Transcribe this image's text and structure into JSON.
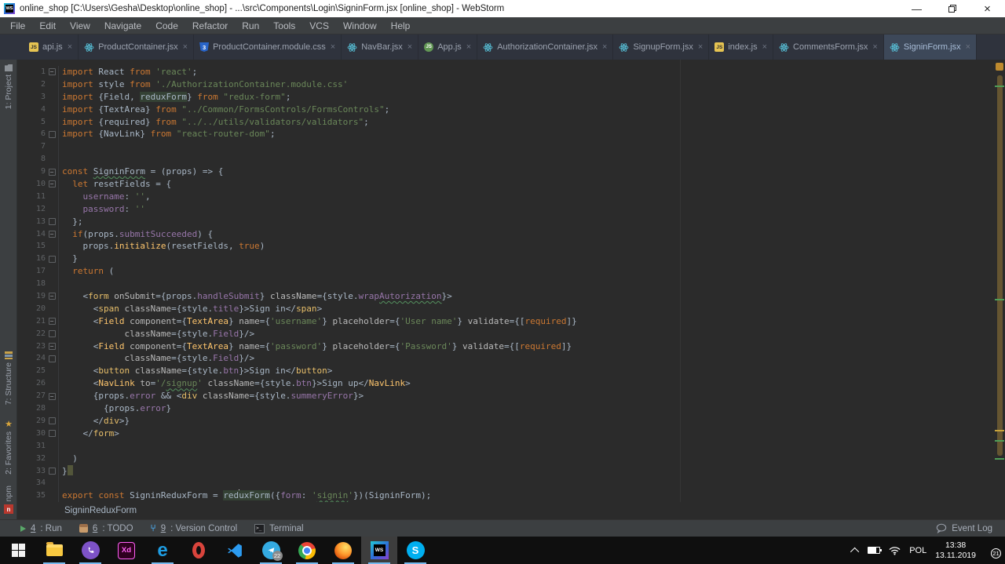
{
  "window": {
    "title": "online_shop [C:\\Users\\Gesha\\Desktop\\online_shop] - ...\\src\\Components\\Login\\SigninForm.jsx [online_shop] - WebStorm",
    "app_icon_label": "WS",
    "controls": {
      "minimize": "—",
      "close": "×"
    }
  },
  "menu": {
    "items": [
      "File",
      "Edit",
      "View",
      "Navigate",
      "Code",
      "Refactor",
      "Run",
      "Tools",
      "VCS",
      "Window",
      "Help"
    ]
  },
  "tabs": {
    "close_glyph": "×",
    "items": [
      {
        "label": "api.js",
        "icon": "js"
      },
      {
        "label": "ProductContainer.jsx",
        "icon": "react"
      },
      {
        "label": "ProductContainer.module.css",
        "icon": "css"
      },
      {
        "label": "NavBar.jsx",
        "icon": "react"
      },
      {
        "label": "App.js",
        "icon": "appjs"
      },
      {
        "label": "AuthorizationContainer.jsx",
        "icon": "react"
      },
      {
        "label": "SignupForm.jsx",
        "icon": "react"
      },
      {
        "label": "index.js",
        "icon": "js"
      },
      {
        "label": "CommentsForm.jsx",
        "icon": "react"
      },
      {
        "label": "SigninForm.jsx",
        "icon": "react",
        "active": true
      }
    ]
  },
  "icon_labels": {
    "js": "JS",
    "appjs": "JS",
    "css": "3",
    "npm": "n",
    "webstorm": "WS",
    "skype": "S",
    "edge": "e",
    "xd": "Xd"
  },
  "sidebar": {
    "items": [
      {
        "label": "1: Project",
        "icon": "project"
      },
      {
        "label": "7: Structure",
        "icon": "structure"
      },
      {
        "label": "2: Favorites",
        "icon": "favorites"
      },
      {
        "label": "npm",
        "icon": "npm"
      }
    ]
  },
  "editor": {
    "breadcrumb": "SigninReduxForm",
    "lines": [
      {
        "n": 1,
        "f": "m",
        "s": [
          [
            "k",
            "import "
          ],
          [
            "i",
            "React "
          ],
          [
            "k",
            "from "
          ],
          [
            "s",
            "'react'"
          ],
          [
            "i",
            ";"
          ]
        ]
      },
      {
        "n": 2,
        "f": "",
        "s": [
          [
            "k",
            "import "
          ],
          [
            "i",
            "style "
          ],
          [
            "k",
            "from "
          ],
          [
            "s",
            "'./AuthorizationContainer.module.css'"
          ]
        ]
      },
      {
        "n": 3,
        "f": "",
        "s": [
          [
            "k",
            "import "
          ],
          [
            "i",
            "{Field, "
          ],
          [
            "h",
            "reduxForm"
          ],
          [
            "i",
            "} "
          ],
          [
            "k",
            "from "
          ],
          [
            "s",
            "\"redux-form\""
          ],
          [
            "i",
            ";"
          ]
        ]
      },
      {
        "n": 4,
        "f": "",
        "s": [
          [
            "k",
            "import "
          ],
          [
            "i",
            "{TextArea} "
          ],
          [
            "k",
            "from "
          ],
          [
            "s",
            "\"../Common/FormsControls/FormsControls\""
          ],
          [
            "i",
            ";"
          ]
        ]
      },
      {
        "n": 5,
        "f": "",
        "s": [
          [
            "k",
            "import "
          ],
          [
            "i",
            "{required} "
          ],
          [
            "k",
            "from "
          ],
          [
            "s",
            "\"../../utils/validators/validators\""
          ],
          [
            "i",
            ";"
          ]
        ]
      },
      {
        "n": 6,
        "f": "e",
        "s": [
          [
            "k",
            "import "
          ],
          [
            "i",
            "{NavLink} "
          ],
          [
            "k",
            "from "
          ],
          [
            "s",
            "\"react-router-dom\""
          ],
          [
            "i",
            ";"
          ]
        ]
      },
      {
        "n": 7,
        "f": "",
        "s": []
      },
      {
        "n": 8,
        "f": "",
        "s": []
      },
      {
        "n": 9,
        "f": "m",
        "s": [
          [
            "k",
            "const "
          ],
          [
            "i w",
            "SigninForm"
          ],
          [
            "i",
            " = (props) => {"
          ]
        ]
      },
      {
        "n": 10,
        "f": "m",
        "s": [
          [
            "i",
            "  "
          ],
          [
            "k",
            "let "
          ],
          [
            "i",
            "resetFields = {"
          ]
        ]
      },
      {
        "n": 11,
        "f": "",
        "s": [
          [
            "i",
            "    "
          ],
          [
            "p",
            "username"
          ],
          [
            "i",
            ": "
          ],
          [
            "s",
            "''"
          ],
          [
            "i",
            ","
          ]
        ]
      },
      {
        "n": 12,
        "f": "",
        "s": [
          [
            "i",
            "    "
          ],
          [
            "p",
            "password"
          ],
          [
            "i",
            ": "
          ],
          [
            "s",
            "''"
          ]
        ]
      },
      {
        "n": 13,
        "f": "e",
        "s": [
          [
            "i",
            "  };"
          ]
        ]
      },
      {
        "n": 14,
        "f": "m",
        "s": [
          [
            "i",
            "  "
          ],
          [
            "k",
            "if"
          ],
          [
            "i",
            "(props."
          ],
          [
            "p",
            "submitSucceeded"
          ],
          [
            "i",
            ") {"
          ]
        ]
      },
      {
        "n": 15,
        "f": "",
        "s": [
          [
            "i",
            "    props."
          ],
          [
            "f",
            "initialize"
          ],
          [
            "i",
            "(resetFields, "
          ],
          [
            "k",
            "true"
          ],
          [
            "i",
            ")"
          ]
        ]
      },
      {
        "n": 16,
        "f": "e",
        "s": [
          [
            "i",
            "  }"
          ]
        ]
      },
      {
        "n": 17,
        "f": "",
        "s": [
          [
            "i",
            "  "
          ],
          [
            "k",
            "return"
          ],
          [
            "i",
            " ("
          ]
        ]
      },
      {
        "n": 18,
        "f": "",
        "s": []
      },
      {
        "n": 19,
        "f": "m",
        "s": [
          [
            "i",
            "    <"
          ],
          [
            "t",
            "form "
          ],
          [
            "a",
            "onSubmit"
          ],
          [
            "i",
            "={props."
          ],
          [
            "p",
            "handleSubmit"
          ],
          [
            "i",
            "} "
          ],
          [
            "a",
            "className"
          ],
          [
            "i",
            "={style."
          ],
          [
            "p",
            "wrap"
          ],
          [
            "p w",
            "Autorization"
          ],
          [
            "i",
            "}>"
          ]
        ]
      },
      {
        "n": 20,
        "f": "",
        "s": [
          [
            "i",
            "      <"
          ],
          [
            "t",
            "span "
          ],
          [
            "a",
            "className"
          ],
          [
            "i",
            "={style."
          ],
          [
            "p",
            "title"
          ],
          [
            "i",
            "}>Sign in</"
          ],
          [
            "t",
            "span"
          ],
          [
            "i",
            ">"
          ]
        ]
      },
      {
        "n": 21,
        "f": "m",
        "s": [
          [
            "i",
            "      <"
          ],
          [
            "c",
            "Field "
          ],
          [
            "a",
            "component"
          ],
          [
            "i",
            "={"
          ],
          [
            "c",
            "TextArea"
          ],
          [
            "i",
            "} "
          ],
          [
            "a",
            "name"
          ],
          [
            "i",
            "={"
          ],
          [
            "s",
            "'username'"
          ],
          [
            "i",
            "} "
          ],
          [
            "a",
            "placeholder"
          ],
          [
            "i",
            "={"
          ],
          [
            "s",
            "'User name'"
          ],
          [
            "i",
            "} "
          ],
          [
            "a",
            "validate"
          ],
          [
            "i",
            "={["
          ],
          [
            "k",
            "required"
          ],
          [
            "i",
            "]}"
          ]
        ]
      },
      {
        "n": 22,
        "f": "e",
        "s": [
          [
            "i",
            "            "
          ],
          [
            "a",
            "className"
          ],
          [
            "i",
            "={style."
          ],
          [
            "p",
            "Field"
          ],
          [
            "i",
            "}/>"
          ]
        ]
      },
      {
        "n": 23,
        "f": "m",
        "s": [
          [
            "i",
            "      <"
          ],
          [
            "c",
            "Field "
          ],
          [
            "a",
            "component"
          ],
          [
            "i",
            "={"
          ],
          [
            "c",
            "TextArea"
          ],
          [
            "i",
            "} "
          ],
          [
            "a",
            "name"
          ],
          [
            "i",
            "={"
          ],
          [
            "s",
            "'password'"
          ],
          [
            "i",
            "} "
          ],
          [
            "a",
            "placeholder"
          ],
          [
            "i",
            "={"
          ],
          [
            "s",
            "'Password'"
          ],
          [
            "i",
            "} "
          ],
          [
            "a",
            "validate"
          ],
          [
            "i",
            "={["
          ],
          [
            "k",
            "required"
          ],
          [
            "i",
            "]}"
          ]
        ]
      },
      {
        "n": 24,
        "f": "e",
        "s": [
          [
            "i",
            "            "
          ],
          [
            "a",
            "className"
          ],
          [
            "i",
            "={style."
          ],
          [
            "p",
            "Field"
          ],
          [
            "i",
            "}/>"
          ]
        ]
      },
      {
        "n": 25,
        "f": "",
        "s": [
          [
            "i",
            "      <"
          ],
          [
            "t",
            "button "
          ],
          [
            "a",
            "className"
          ],
          [
            "i",
            "={style."
          ],
          [
            "p",
            "btn"
          ],
          [
            "i",
            "}>Sign in</"
          ],
          [
            "t",
            "button"
          ],
          [
            "i",
            ">"
          ]
        ]
      },
      {
        "n": 26,
        "f": "",
        "s": [
          [
            "i",
            "      <"
          ],
          [
            "c",
            "NavLink "
          ],
          [
            "a",
            "to"
          ],
          [
            "i",
            "="
          ],
          [
            "s",
            "'/"
          ],
          [
            "s w",
            "signup"
          ],
          [
            "s",
            "'"
          ],
          [
            "i",
            " "
          ],
          [
            "a",
            "className"
          ],
          [
            "i",
            "={style."
          ],
          [
            "p",
            "btn"
          ],
          [
            "i",
            "}>Sign up</"
          ],
          [
            "c",
            "NavLink"
          ],
          [
            "i",
            ">"
          ]
        ]
      },
      {
        "n": 27,
        "f": "m",
        "s": [
          [
            "i",
            "      {props."
          ],
          [
            "p",
            "error"
          ],
          [
            "i",
            " && <"
          ],
          [
            "t",
            "div "
          ],
          [
            "a",
            "className"
          ],
          [
            "i",
            "={style."
          ],
          [
            "p",
            "summeryError"
          ],
          [
            "i",
            "}>"
          ]
        ]
      },
      {
        "n": 28,
        "f": "",
        "s": [
          [
            "i",
            "        {props."
          ],
          [
            "p",
            "error"
          ],
          [
            "i",
            "}"
          ]
        ]
      },
      {
        "n": 29,
        "f": "e",
        "s": [
          [
            "i",
            "      </"
          ],
          [
            "t",
            "div"
          ],
          [
            "i",
            ">}"
          ]
        ]
      },
      {
        "n": 30,
        "f": "e",
        "s": [
          [
            "i",
            "    </"
          ],
          [
            "t",
            "form"
          ],
          [
            "i",
            ">"
          ]
        ]
      },
      {
        "n": 31,
        "f": "",
        "s": []
      },
      {
        "n": 32,
        "f": "",
        "s": [
          [
            "i",
            "  )"
          ]
        ]
      },
      {
        "n": 33,
        "f": "e",
        "s": [
          [
            "i",
            "}"
          ],
          [
            "b",
            ""
          ]
        ]
      },
      {
        "n": 34,
        "f": "",
        "s": []
      },
      {
        "n": 35,
        "f": "",
        "s": [
          [
            "k",
            "export const "
          ],
          [
            "i",
            "SigninReduxForm = "
          ],
          [
            "h",
            "red"
          ],
          [
            "r",
            ""
          ],
          [
            "h",
            "uxForm"
          ],
          [
            "i",
            "({"
          ],
          [
            "p",
            "form"
          ],
          [
            "i",
            ": "
          ],
          [
            "s",
            "'"
          ],
          [
            "s w",
            "signin"
          ],
          [
            "s",
            "'"
          ],
          [
            "i",
            "})(SigninForm);"
          ]
        ]
      }
    ]
  },
  "toolbar": {
    "items": [
      {
        "num": "4",
        "label": "Run",
        "icon": "run"
      },
      {
        "num": "6",
        "label": "TODO",
        "icon": "todo"
      },
      {
        "num": "9",
        "label": "Version Control",
        "icon": "vcs"
      },
      {
        "num": "",
        "label": "Terminal",
        "icon": "terminal"
      }
    ],
    "right": {
      "label": "Event Log"
    }
  },
  "taskbar": {
    "telegram_badge": "22"
  },
  "tray": {
    "lang": "POL",
    "time": "13:38",
    "date": "13.11.2019",
    "notification_count": "21"
  },
  "colors": {
    "editor_bg": "#2B2B2B",
    "keyword": "#CC7832",
    "string": "#6A8759",
    "plain": "#A9B7C6",
    "property": "#9876AA",
    "function": "#FFC66D",
    "tag": "#E8BF6A",
    "attribute": "#BABABA",
    "usage_highlight_bg": "#344134",
    "active_tab_bg": "#3D4859",
    "taskbar_indicator": "#76B9ED"
  }
}
